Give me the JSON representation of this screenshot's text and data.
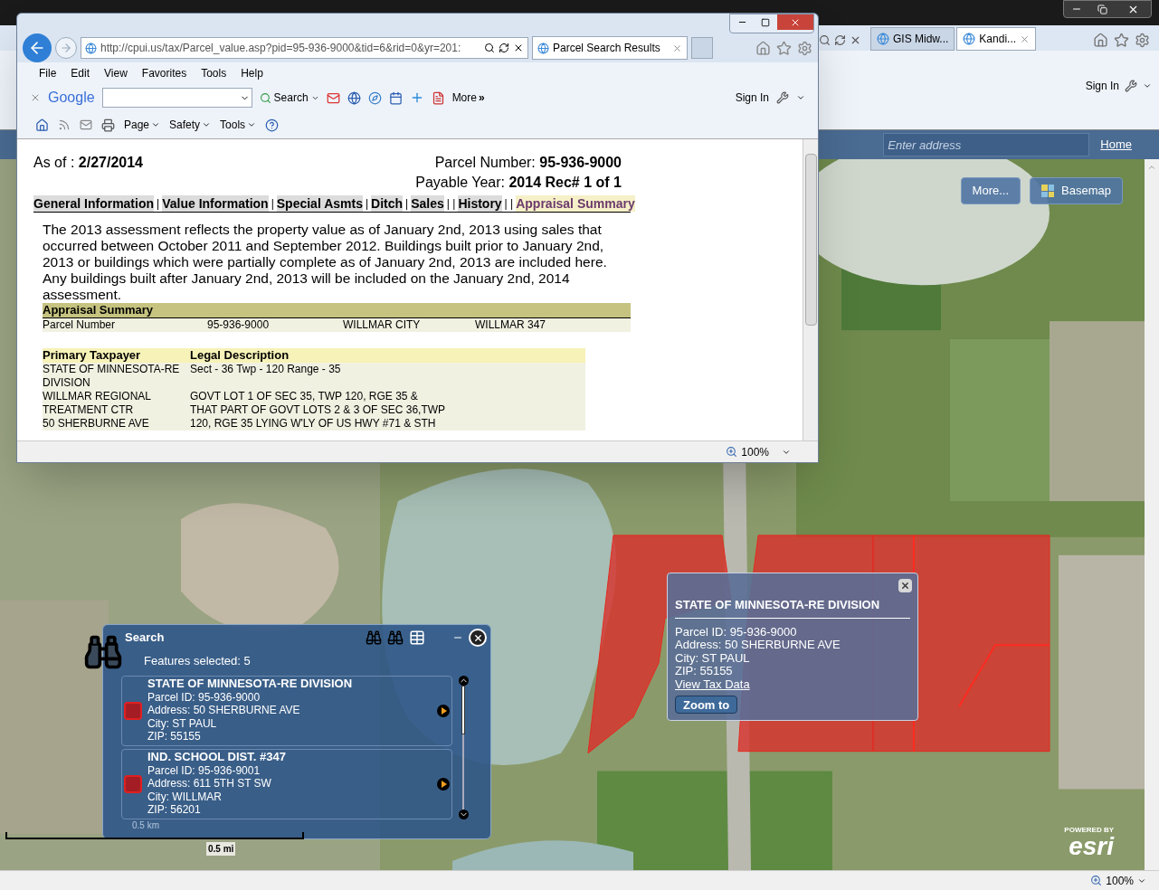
{
  "background_browser": {
    "tabs": [
      {
        "label": "GIS Midw...",
        "selected": false
      },
      {
        "label": "Kandi...",
        "selected": true
      }
    ],
    "sign_in": "Sign In",
    "map_app": {
      "address_placeholder": "Enter address",
      "home_link": "Home",
      "buttons": [
        {
          "label": "More...",
          "kind": "text"
        },
        {
          "label": "Basemap",
          "kind": "basemap"
        }
      ],
      "scale": {
        "km": "0.5 km",
        "mi": "0.5 mi"
      },
      "logo": {
        "top": "POWERED BY",
        "main": "esri"
      }
    },
    "status_zoom": "100%"
  },
  "popup_browser": {
    "url": "http://cpui.us/tax/Parcel_value.asp?pid=95-936-9000&tid=6&rid=0&yr=201:",
    "tab": "Parcel Search Results",
    "menu": [
      "File",
      "Edit",
      "View",
      "Favorites",
      "Tools",
      "Help"
    ],
    "google": {
      "logo": "Google",
      "search": "Search",
      "more": "More",
      "more_glyph": "»",
      "sign_in": "Sign In"
    },
    "command_bar": [
      "Page",
      "Safety",
      "Tools"
    ],
    "page": {
      "as_of": {
        "label": "As of : ",
        "value": "2/27/2014"
      },
      "parcel_number": {
        "label": "Parcel Number: ",
        "value": "95-936-9000"
      },
      "payable_year": {
        "label": "Payable Year: ",
        "value": "2014 Rec# 1 of 1"
      },
      "nav": [
        {
          "label": "General Information",
          "separator": "|",
          "selected": false
        },
        {
          "label": "Value Information",
          "separator": "|",
          "selected": false
        },
        {
          "label": "Special Asmts",
          "separator": "|",
          "selected": false
        },
        {
          "label": "Ditch",
          "separator": "|",
          "selected": false
        },
        {
          "label": "Sales",
          "separator": "| |",
          "selected": false
        },
        {
          "label": "History",
          "separator": "| |",
          "selected": false
        },
        {
          "label": "Appraisal Summary",
          "selected": true
        }
      ],
      "paragraph": "The 2013 assessment reflects the property value as of January 2nd, 2013 using sales that occurred between October 2011 and September 2012. Buildings built prior to January 2nd, 2013 or buildings which were partially complete as of January 2nd, 2013 are included here. Any buildings built after January 2nd, 2013 will be included on the January 2nd, 2014 assessment.",
      "summary": {
        "title": "Appraisal Summary",
        "row": [
          "Parcel Number",
          "95-936-9000",
          "WILLMAR CITY",
          "WILLMAR 347"
        ]
      },
      "taxpayer_table": {
        "headers": [
          "Primary Taxpayer",
          "Legal Description"
        ],
        "rows": [
          {
            "taxpayer": "STATE OF MINNESOTA-RE",
            "legal": "Sect - 36 Twp - 120 Range - 35"
          },
          {
            "taxpayer": "DIVISION"
          },
          {
            "taxpayer": "WILLMAR REGIONAL",
            "legal": "GOVT LOT 1 OF SEC 35, TWP 120, RGE 35 &"
          },
          {
            "taxpayer": "TREATMENT CTR",
            "legal": "THAT PART OF GOVT LOTS 2 & 3 OF SEC 36,TWP"
          },
          {
            "taxpayer": "50 SHERBURNE AVE",
            "legal": "120, RGE 35 LYING W'LY OF US HWY #71 & STH"
          }
        ]
      }
    },
    "zoom": "100%"
  },
  "search_panel": {
    "title": "Search",
    "count": "Features selected: 5",
    "results": [
      {
        "name": "STATE OF MINNESOTA-RE DIVISION",
        "lines": [
          "Parcel ID: 95-936-9000",
          "Address: 50 SHERBURNE AVE",
          "City: ST PAUL",
          "ZIP: 55155"
        ],
        "color": "#a51d24"
      },
      {
        "name": "IND. SCHOOL DIST. #347",
        "lines": [
          "Parcel ID: 95-936-9001",
          "Address: 611 5TH ST SW",
          "City: WILLMAR",
          "ZIP: 56201"
        ],
        "color": "#a51d24"
      }
    ]
  },
  "info_popup": {
    "title": "STATE OF MINNESOTA-RE DIVISION",
    "lines": [
      "Parcel ID: 95-936-9000",
      "Address: 50 SHERBURNE AVE",
      "City: ST PAUL",
      "ZIP: 55155"
    ],
    "link": "View Tax Data",
    "button": "Zoom to"
  }
}
